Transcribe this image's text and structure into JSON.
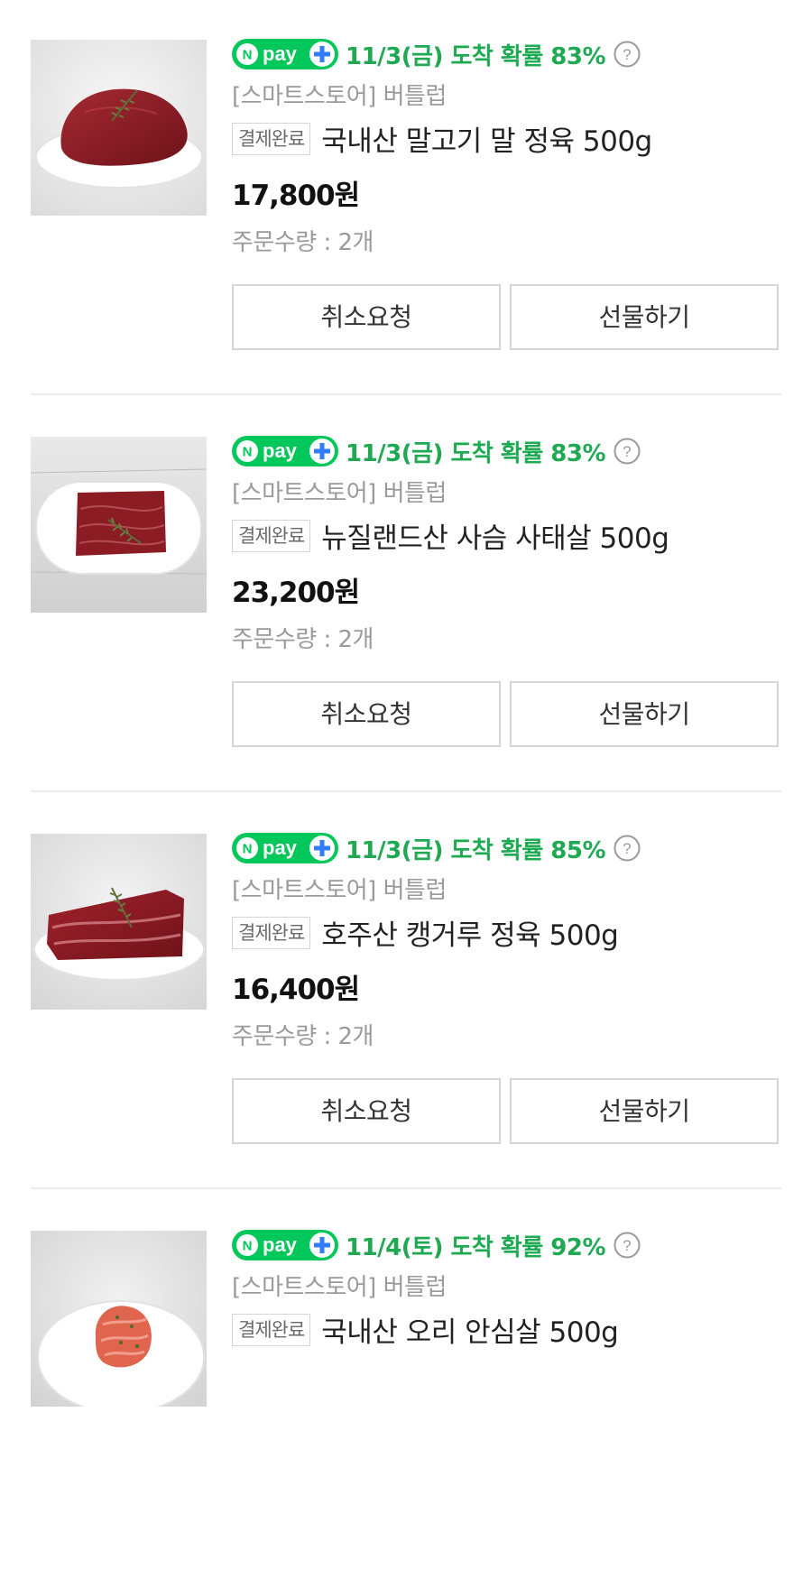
{
  "orders": [
    {
      "npay_label": "pay",
      "delivery": "11/3(금) 도착 확률 83%",
      "store": "[스마트스토어] 버틀럽",
      "status": "결제완료",
      "name": "국내산 말고기 말 정육 500g",
      "price": "17,800원",
      "qty_label": "주문수량",
      "qty_sep": " : ",
      "qty_value": "2개",
      "cancel_label": "취소요청",
      "gift_label": "선물하기",
      "thumb_icon": "horse-meat-on-plate-image"
    },
    {
      "npay_label": "pay",
      "delivery": "11/3(금) 도착 확률 83%",
      "store": "[스마트스토어] 버틀럽",
      "status": "결제완료",
      "name": "뉴질랜드산 사슴 사태살 500g",
      "price": "23,200원",
      "qty_label": "주문수량",
      "qty_sep": " : ",
      "qty_value": "2개",
      "cancel_label": "취소요청",
      "gift_label": "선물하기",
      "thumb_icon": "venison-shank-on-plate-image"
    },
    {
      "npay_label": "pay",
      "delivery": "11/3(금) 도착 확률 85%",
      "store": "[스마트스토어] 버틀럽",
      "status": "결제완료",
      "name": "호주산 캥거루 정육 500g",
      "price": "16,400원",
      "qty_label": "주문수량",
      "qty_sep": " : ",
      "qty_value": "2개",
      "cancel_label": "취소요청",
      "gift_label": "선물하기",
      "thumb_icon": "kangaroo-meat-on-plate-image"
    },
    {
      "npay_label": "pay",
      "delivery": "11/4(토) 도착 확률 92%",
      "store": "[스마트스토어] 버틀럽",
      "status": "결제완료",
      "name": "국내산 오리 안심살 500g",
      "price": "",
      "qty_label": "",
      "qty_sep": "",
      "qty_value": "",
      "cancel_label": "",
      "gift_label": "",
      "thumb_icon": "duck-tenderloin-on-plate-image"
    }
  ],
  "colors": {
    "npay_green": "#03c75a",
    "delivery_green": "#1ea952",
    "npay_plus_blue": "#2f7df6",
    "meat_red": "#8c1c24",
    "duck_pink": "#e0654f"
  }
}
